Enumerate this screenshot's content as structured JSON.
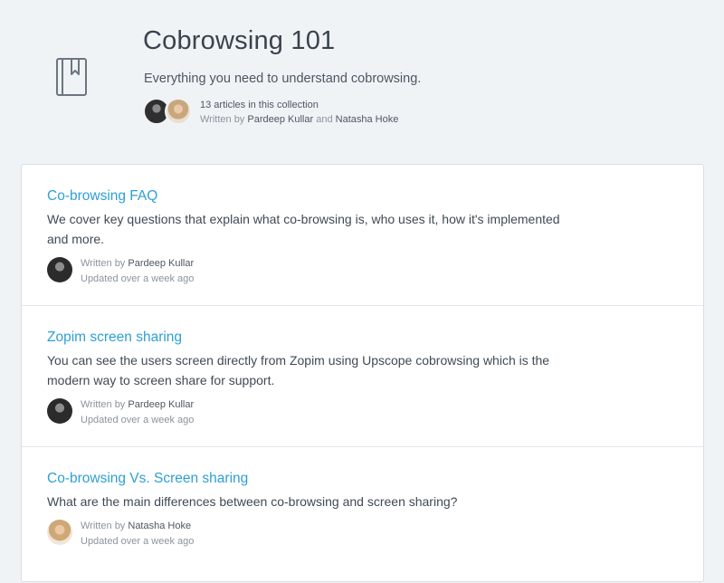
{
  "collection": {
    "title": "Cobrowsing 101",
    "description": "Everything you need to understand cobrowsing.",
    "article_count": "13 articles in this collection",
    "written_by_prefix": "Written by",
    "author_1": "Pardeep Kullar",
    "and_word": "and",
    "author_2": "Natasha Hoke",
    "icon": "book-bookmark-icon"
  },
  "articles": [
    {
      "title": "Co-browsing FAQ",
      "description": "We cover key questions that explain what co-browsing is, who uses it, how it's implemented and more.",
      "written_by_prefix": "Written by",
      "author": "Pardeep Kullar",
      "updated": "Updated over a week ago"
    },
    {
      "title": "Zopim screen sharing",
      "description": "You can see the users screen directly from Zopim using Upscope cobrowsing which is the modern way to screen share for support.",
      "written_by_prefix": "Written by",
      "author": "Pardeep Kullar",
      "updated": "Updated over a week ago"
    },
    {
      "title": "Co-browsing Vs. Screen sharing",
      "description": "What are the main differences between co-browsing and screen sharing?",
      "written_by_prefix": "Written by",
      "author": "Natasha Hoke",
      "updated": "Updated over a week ago"
    }
  ],
  "colors": {
    "background": "#f0f3f6",
    "link": "#2e9fd6",
    "text": "#3f4a55",
    "muted": "#8a949e"
  }
}
